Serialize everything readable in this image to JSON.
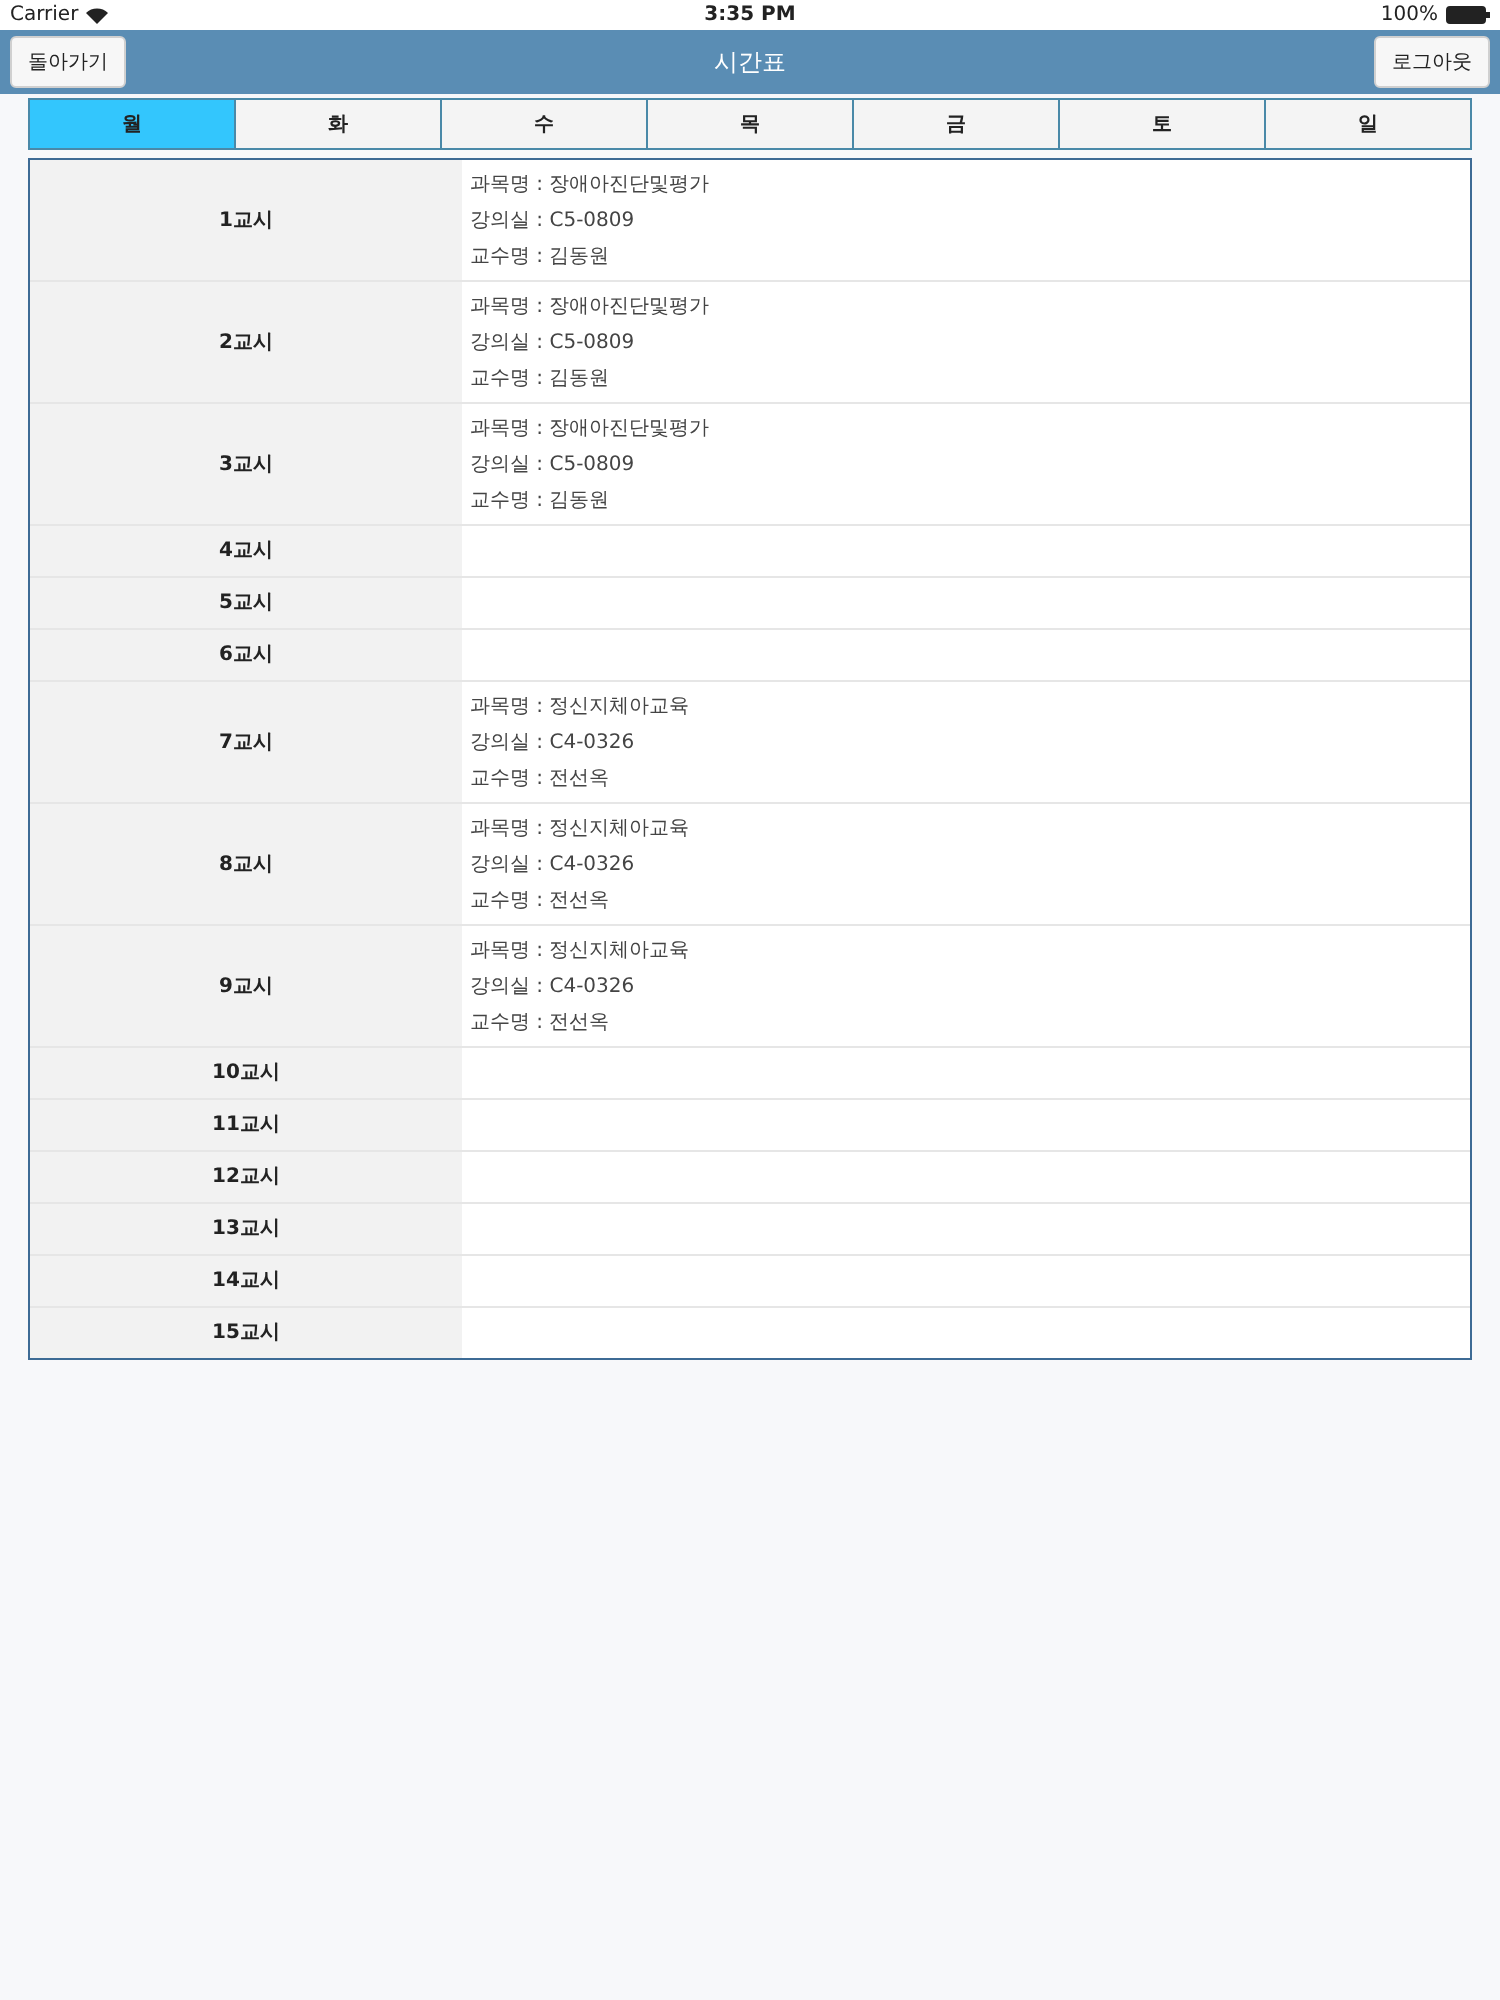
{
  "status_bar": {
    "carrier": "Carrier",
    "time": "3:35 PM",
    "battery": "100%"
  },
  "nav": {
    "back": "돌아가기",
    "title": "시간표",
    "logout": "로그아웃"
  },
  "tabs": [
    {
      "label": "월",
      "selected": true
    },
    {
      "label": "화",
      "selected": false
    },
    {
      "label": "수",
      "selected": false
    },
    {
      "label": "목",
      "selected": false
    },
    {
      "label": "금",
      "selected": false
    },
    {
      "label": "토",
      "selected": false
    },
    {
      "label": "일",
      "selected": false
    }
  ],
  "rows": [
    {
      "period": "1교시",
      "lines": [
        "과목명 : 장애아진단및평가",
        "강의실 : C5-0809",
        "교수명 : 김동원"
      ]
    },
    {
      "period": "2교시",
      "lines": [
        "과목명 : 장애아진단및평가",
        "강의실 : C5-0809",
        "교수명 : 김동원"
      ]
    },
    {
      "period": "3교시",
      "lines": [
        "과목명 : 장애아진단및평가",
        "강의실 : C5-0809",
        "교수명 : 김동원"
      ]
    },
    {
      "period": "4교시"
    },
    {
      "period": "5교시"
    },
    {
      "period": "6교시"
    },
    {
      "period": "7교시",
      "lines": [
        "과목명 : 정신지체아교육",
        "강의실 : C4-0326",
        "교수명 : 전선옥"
      ]
    },
    {
      "period": "8교시",
      "lines": [
        "과목명 : 정신지체아교육",
        "강의실 : C4-0326",
        "교수명 : 전선옥"
      ]
    },
    {
      "period": "9교시",
      "lines": [
        "과목명 : 정신지체아교육",
        "강의실 : C4-0326",
        "교수명 : 전선옥"
      ]
    },
    {
      "period": "10교시"
    },
    {
      "period": "11교시"
    },
    {
      "period": "12교시"
    },
    {
      "period": "13교시"
    },
    {
      "period": "14교시"
    },
    {
      "period": "15교시"
    }
  ]
}
